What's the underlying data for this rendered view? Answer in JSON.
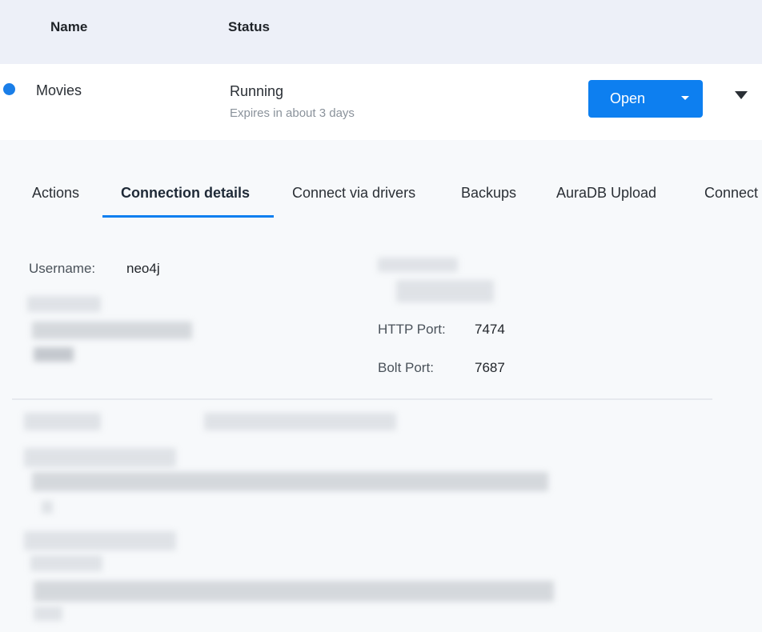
{
  "table": {
    "headers": {
      "name": "Name",
      "status": "Status"
    }
  },
  "database": {
    "name": "Movies",
    "status": "Running",
    "expires": "Expires in about 3 days",
    "open_label": "Open",
    "status_color": "#1a7ee8"
  },
  "tabs": [
    {
      "label": "Actions"
    },
    {
      "label": "Connection details",
      "active": true
    },
    {
      "label": "Connect via drivers"
    },
    {
      "label": "Backups"
    },
    {
      "label": "AuraDB Upload"
    },
    {
      "label": "Connect"
    }
  ],
  "connection": {
    "username_label": "Username:",
    "username": "neo4j",
    "http_port_label": "HTTP Port:",
    "http_port": "7474",
    "bolt_port_label": "Bolt Port:",
    "bolt_port": "7687"
  },
  "colors": {
    "accent": "#0d7ff0",
    "header_bg": "#edf0f8",
    "panel_bg": "#f7f9fb"
  }
}
